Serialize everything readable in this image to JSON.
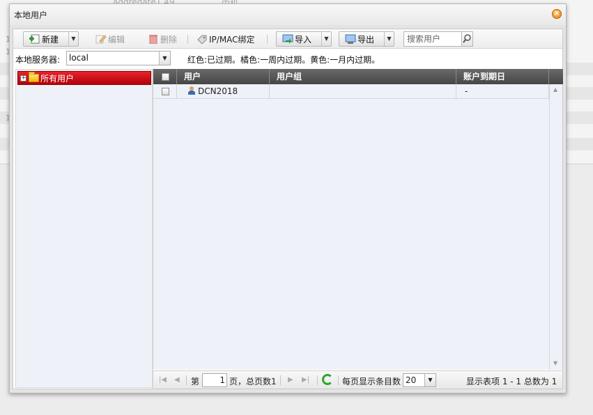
{
  "background": {
    "partial_row_text": "aggregate1.49",
    "partial_type_text": "中机",
    "row_numbers": [
      "1",
      "1",
      "1"
    ]
  },
  "dialog": {
    "title": "本地用户",
    "close_glyph": "×"
  },
  "toolbar": {
    "new_label": "新建",
    "edit_label": "编辑",
    "delete_label": "删除",
    "ipmac_label": "IP/MAC绑定",
    "import_label": "导入",
    "export_label": "导出",
    "search_placeholder": "搜索用户"
  },
  "server": {
    "label": "本地服务器:",
    "value": "local",
    "legend_note": "红色:已过期。橘色:一周内过期。黄色:一月内过期。"
  },
  "tree": {
    "root_label": "所有用户",
    "expander_glyph": "+"
  },
  "grid": {
    "columns": [
      "用户",
      "用户组",
      "账户到期日"
    ],
    "rows": [
      {
        "user": "DCN2018",
        "group": "",
        "expiry": "-"
      }
    ]
  },
  "pager": {
    "page_prefix": "第",
    "current_page": "1",
    "page_suffix": "页，总页数1",
    "per_page_label": "每页显示条目数",
    "per_page_value": "20",
    "summary": "显示表项 1 - 1 总数为 1"
  },
  "colors": {
    "selected_tree_node": "#d4101a",
    "grid_header": "#555555",
    "refresh_icon": "#2fa52f",
    "close_icon": "#e47a00"
  }
}
